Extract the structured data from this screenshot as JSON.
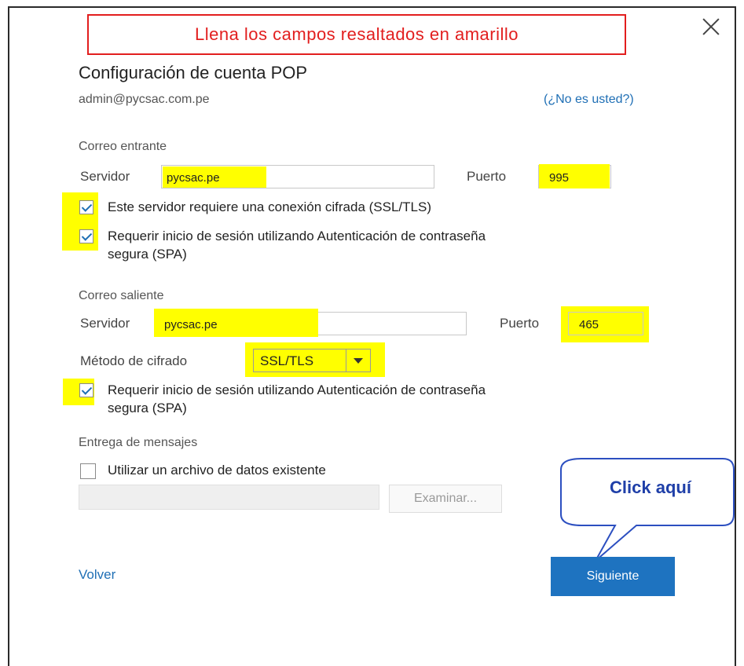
{
  "banner": {
    "text": "Llena los campos resaltados en amarillo"
  },
  "header": {
    "title": "Configuración de cuenta POP",
    "email": "admin@pycsac.com.pe",
    "not_you": "(¿No es usted?)"
  },
  "incoming": {
    "section_label": "Correo entrante",
    "server_label": "Servidor",
    "server_value": "pycsac.pe",
    "port_label": "Puerto",
    "port_value": "995",
    "ssl_label": "Este servidor requiere una conexión cifrada (SSL/TLS)",
    "ssl_checked": true,
    "spa_label_line1": "Requerir inicio de sesión utilizando Autenticación de contraseña",
    "spa_label_line2": "segura (SPA)",
    "spa_checked": true
  },
  "outgoing": {
    "section_label": "Correo saliente",
    "server_label": "Servidor",
    "server_value": "pycsac.pe",
    "port_label": "Puerto",
    "port_value": "465",
    "encryption_label": "Método de cifrado",
    "encryption_value": "SSL/TLS",
    "spa_label_line1": "Requerir inicio de sesión utilizando Autenticación de contraseña",
    "spa_label_line2": "segura (SPA)",
    "spa_checked": true
  },
  "delivery": {
    "section_label": "Entrega de mensajes",
    "existing_file_label": "Utilizar un archivo de datos existente",
    "existing_file_checked": false,
    "file_path_value": "",
    "browse_label": "Examinar..."
  },
  "callout": {
    "text": "Click aquí"
  },
  "footer": {
    "back_label": "Volver",
    "next_label": "Siguiente"
  },
  "colors": {
    "highlight": "#ffff00",
    "accent": "#1e73c0",
    "banner_red": "#e21e1e",
    "callout_blue": "#1f3fa8"
  }
}
